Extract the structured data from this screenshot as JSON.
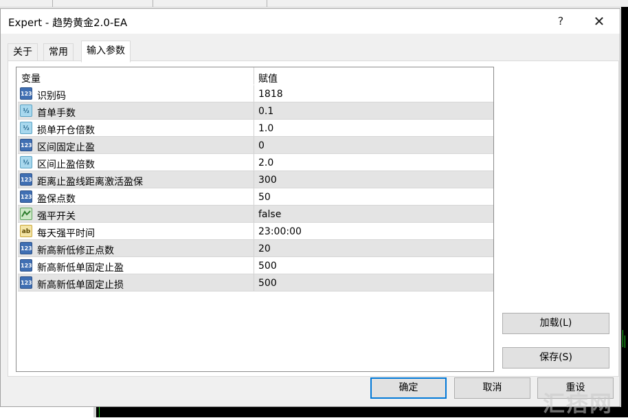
{
  "window": {
    "title": "Expert - 趋势黄金2.0-EA",
    "help_label": "?",
    "close_label": "✕"
  },
  "tabs": [
    {
      "label": "关于"
    },
    {
      "label": "常用"
    },
    {
      "label": "输入参数"
    }
  ],
  "table": {
    "headers": {
      "variable": "变量",
      "value": "赋值"
    },
    "rows": [
      {
        "icon": "int-type-icon",
        "icon_text": "123",
        "name": "识别码",
        "value": "1818"
      },
      {
        "icon": "double-type-icon",
        "icon_text": "½",
        "name": "首单手数",
        "value": "0.1"
      },
      {
        "icon": "double-type-icon",
        "icon_text": "½",
        "name": "损单开仓倍数",
        "value": "1.0"
      },
      {
        "icon": "int-type-icon",
        "icon_text": "123",
        "name": "区间固定止盈",
        "value": "0"
      },
      {
        "icon": "double-type-icon",
        "icon_text": "½",
        "name": "区间止盈倍数",
        "value": "2.0"
      },
      {
        "icon": "int-type-icon",
        "icon_text": "123",
        "name": "距离止盈线距离激活盈保",
        "value": "300"
      },
      {
        "icon": "int-type-icon",
        "icon_text": "123",
        "name": "盈保点数",
        "value": "50"
      },
      {
        "icon": "bool-type-icon",
        "icon_text": "",
        "name": "强平开关",
        "value": "false"
      },
      {
        "icon": "string-type-icon",
        "icon_text": "ab",
        "name": "每天强平时间",
        "value": "23:00:00"
      },
      {
        "icon": "int-type-icon",
        "icon_text": "123",
        "name": "新高新低修正点数",
        "value": "20"
      },
      {
        "icon": "int-type-icon",
        "icon_text": "123",
        "name": "新高新低单固定止盈",
        "value": "500"
      },
      {
        "icon": "int-type-icon",
        "icon_text": "123",
        "name": "新高新低单固定止损",
        "value": "500"
      }
    ]
  },
  "buttons": {
    "load": "加载(L)",
    "save": "保存(S)",
    "ok": "确定",
    "cancel": "取消",
    "reset": "重设"
  },
  "watermark": "汇痞网",
  "colors": {
    "accent": "#0078d7",
    "row_alt": "#e4e4e4",
    "int_icon": "#3f6fb3",
    "double_icon": "#a8d8ee",
    "bool_icon": "#cde8c6",
    "string_icon": "#f4e5a6"
  }
}
